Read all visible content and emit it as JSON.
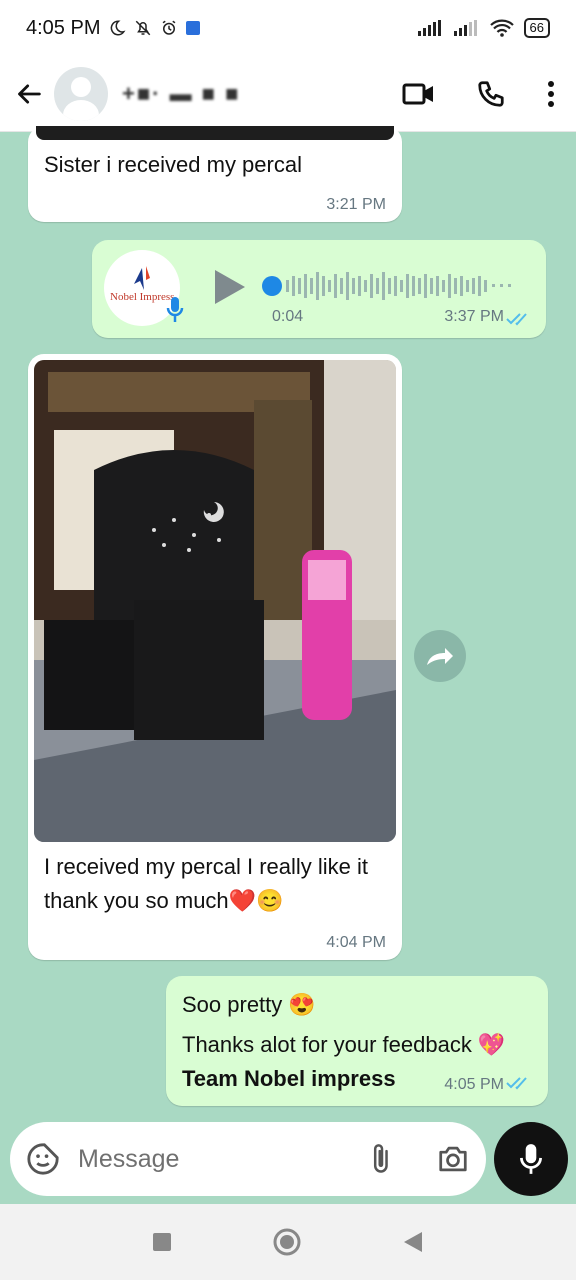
{
  "status_bar": {
    "time": "4:05 PM",
    "battery": "66"
  },
  "header": {
    "contact_name": "+■· ▬ ■  ■",
    "icons": [
      "back-arrow-icon",
      "video-call-icon",
      "phone-call-icon",
      "more-options-icon"
    ]
  },
  "messages": [
    {
      "type": "text",
      "direction": "incoming",
      "text": "Sister i received my percal",
      "time": "3:21 PM"
    },
    {
      "type": "voice",
      "direction": "outgoing",
      "avatar_label": "Nobel Impress",
      "duration": "0:04",
      "time": "3:37 PM",
      "read": true
    },
    {
      "type": "image",
      "direction": "incoming",
      "caption": "I received my percal I really like it thank you so much❤️😊",
      "time": "4:04 PM"
    },
    {
      "type": "text",
      "direction": "outgoing",
      "line1": "Soo pretty 😍",
      "line2": "Thanks alot for your feedback 💖",
      "line3": "Team Nobel impress",
      "time": "4:05 PM",
      "read": true
    }
  ],
  "composer": {
    "placeholder": "Message"
  },
  "colors": {
    "chat_background": "#a9d9c3",
    "outgoing_bubble": "#d9fdd3",
    "incoming_bubble": "#ffffff",
    "read_tick": "#53bdeb",
    "voice_dot": "#1e88e5"
  }
}
